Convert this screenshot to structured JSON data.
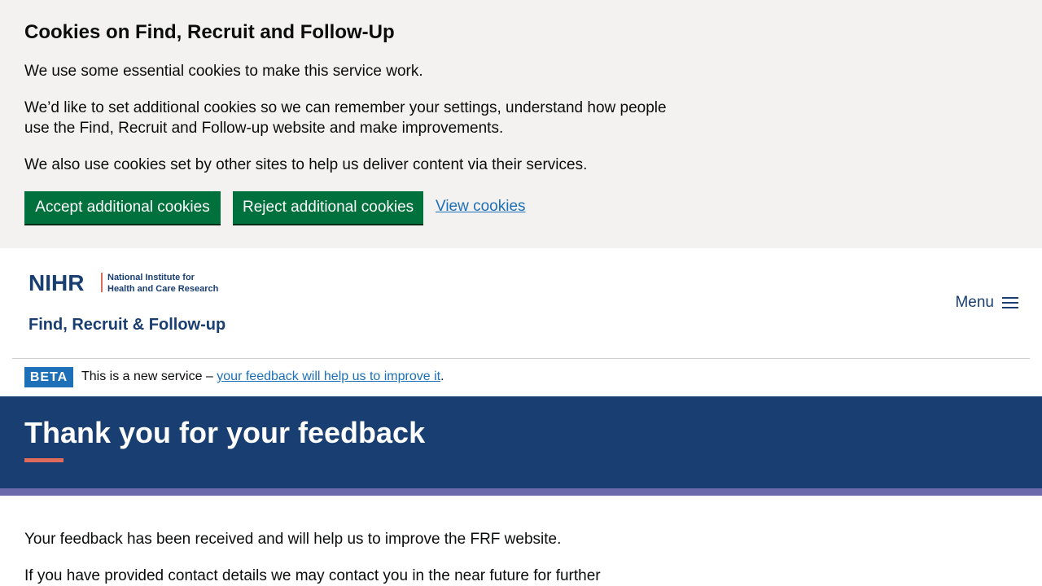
{
  "cookie_banner": {
    "title": "Cookies on Find, Recruit and Follow-Up",
    "paragraph_1": "We use some essential cookies to make this service work.",
    "paragraph_2": "We’d like to set additional cookies so we can remember your settings, understand how people use the Find, Recruit and Follow-up website and make improvements.",
    "paragraph_3": "We also use cookies set by other sites to help us deliver content via their services.",
    "accept_label": "Accept additional cookies",
    "reject_label": "Reject additional cookies",
    "view_label": "View cookies"
  },
  "header": {
    "logo_org_short": "NIHR",
    "logo_org_line1": "National Institute for",
    "logo_org_line2": "Health and Care Research",
    "logo_service": "Find, Recruit & Follow-up",
    "menu_label": "Menu"
  },
  "phase_banner": {
    "tag": "BETA",
    "text_before": "This is a new service – ",
    "link_text": "your feedback will help us to improve it",
    "text_after": "."
  },
  "hero": {
    "title": "Thank you for your feedback"
  },
  "content": {
    "paragraph_1": "Your feedback has been received and will help us to improve the FRF website.",
    "paragraph_2": "If you have provided contact details we may contact you in the near future for further"
  },
  "colors": {
    "cookie_banner_bg": "#f3f2f1",
    "button_green": "#00703c",
    "link_blue": "#1d70b8",
    "brand_navy": "#193e72",
    "accent_red": "#e16b5b",
    "stripe_purple": "#6c6aab"
  }
}
